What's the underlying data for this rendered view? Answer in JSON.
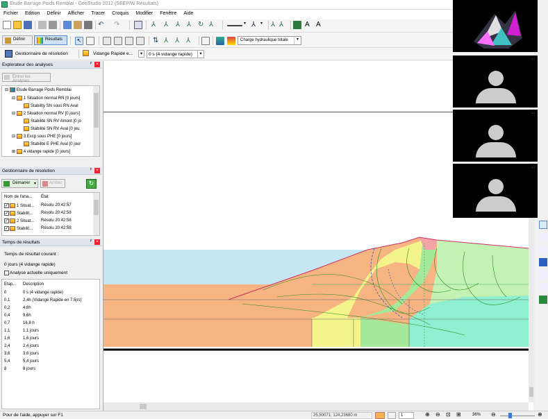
{
  "window": {
    "title": "Etude Barrage Poids Remblai - GeoStudio 2012 (SEEP/W Résultats)"
  },
  "menu": [
    "Fichier",
    "Edition",
    "Définir",
    "Afficher",
    "Tracer",
    "Croquis",
    "Modifier",
    "Fenêtre",
    "Aide"
  ],
  "toolbar2": {
    "define_label": "Définir",
    "results_label": "Résultats",
    "dropdown_value": "Charge hydraulique totale"
  },
  "toolbar3": {
    "solve_manager_label": "Gestionnaire de résolution",
    "analysis_select": "Vidange Rapide e...",
    "time_select": "0 s (4 vidange rapide)"
  },
  "explorer": {
    "title": "Explorateur des analyses",
    "enter_button": "Entrer les Analyses",
    "tree": [
      "Etude Barrage Poids Remblai",
      "1 Situation normal RN [0 jours]",
      "Stability SN sous RN Aval",
      "2 Situation normal RV [0 jours]",
      "Stabilité SN RV Amont [0 jo",
      "Stabilité SN RV Aval [0 jou",
      "3 Excp sous PHE [0 jours]",
      "Stabilité E PHE Aval [0 jour",
      "4 vidange rapide [0 jours]"
    ]
  },
  "solver": {
    "title": "Gestionnaire de résolution",
    "start_label": "Démarrer",
    "stop_label": "Arrêter",
    "col_name": "Nom de l'ana...",
    "col_state": "État",
    "rows": [
      {
        "name": "1 Situat...",
        "state": "Résolu 20:42:57"
      },
      {
        "name": "Stabilit...",
        "state": "Résolu 20:42:58"
      },
      {
        "name": "2 Situat...",
        "state": "Résolu 20:42:58"
      },
      {
        "name": "Stabilit...",
        "state": "Résolu 20:42:58"
      }
    ]
  },
  "results_time": {
    "title": "Temps de résultats",
    "current_label": "Temps de résultat courant :",
    "current_value": "0 jours (4 vidange rapide)",
    "checkbox_label": "Analyse actuelle uniquement",
    "col_step": "Etap...",
    "col_desc": "Description",
    "rows": [
      {
        "step": "0",
        "desc": "0 s (4 vidange rapide)"
      },
      {
        "step": "0,1",
        "desc": "2,4h (Vidange Rapide en 7,5jrs)"
      },
      {
        "step": "0,2",
        "desc": "4,8h"
      },
      {
        "step": "0,4",
        "desc": "9,6h"
      },
      {
        "step": "0,7",
        "desc": "16,8 h"
      },
      {
        "step": "1,1",
        "desc": "1,1 jours"
      },
      {
        "step": "1,6",
        "desc": "1,6 jours"
      },
      {
        "step": "2,4",
        "desc": "2,4 jours"
      },
      {
        "step": "3,6",
        "desc": "3,6 jours"
      },
      {
        "step": "5,4",
        "desc": "5,4 jours"
      },
      {
        "step": "8",
        "desc": "8 jours"
      }
    ]
  },
  "status": {
    "help": "Pour de l'aide, appuyer sur F1",
    "coords": "25,50071; 124,23680 m",
    "page": "1",
    "zoom": "36%"
  },
  "colors": {
    "water": "#c6e6f2",
    "orange": "#f5b482",
    "yellow": "#f4f48c",
    "green": "#a4e89a",
    "cyan": "#8ef0d0",
    "light_green": "#c4f2b4",
    "pink": "#f4a4a4"
  }
}
